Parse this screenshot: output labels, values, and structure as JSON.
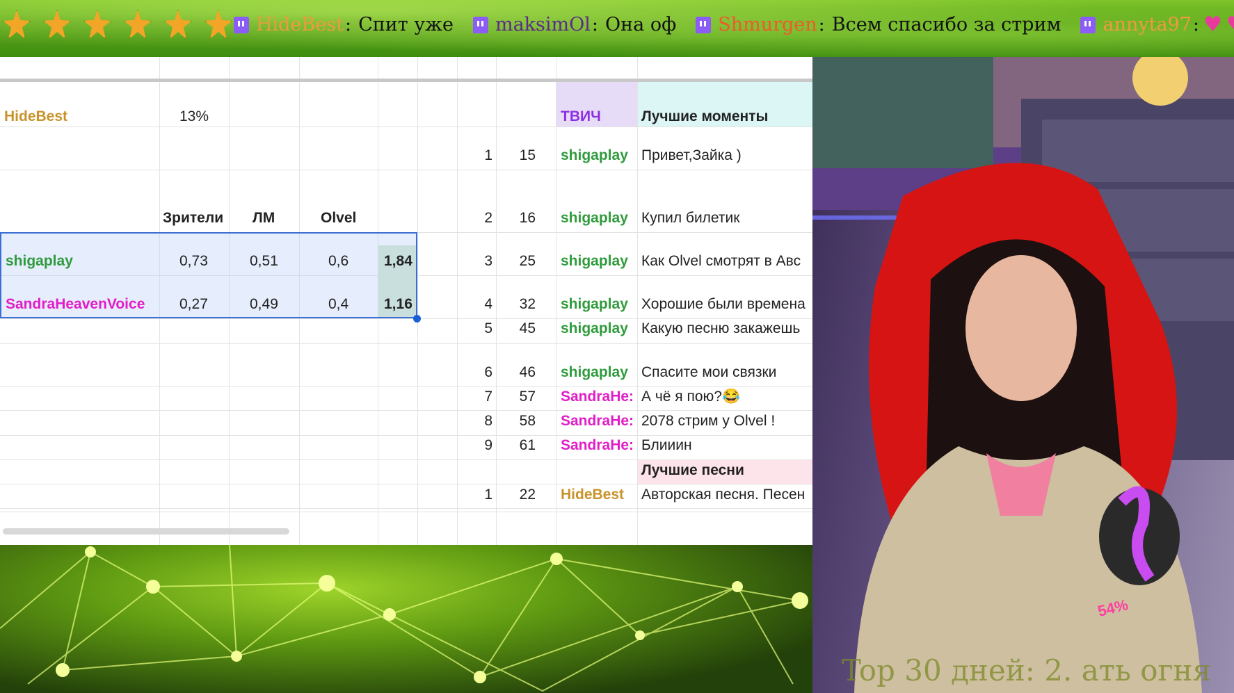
{
  "chat": {
    "messages": [
      {
        "user": "HideBest",
        "sep": ":",
        "text": "Спит уже",
        "user_color": "#f09a3e"
      },
      {
        "user": "maksimOl",
        "sep": ":",
        "text": "Она оф",
        "user_color": "#5b2a8c"
      },
      {
        "user": "Shmurgen",
        "sep": ":",
        "text": "Всем спасибо за стрим",
        "user_color": "#f05a2a"
      },
      {
        "user": "annyta97",
        "sep": ":",
        "text": "",
        "user_color": "#f09a3e"
      }
    ],
    "star_icon": "star-badge-icon",
    "platform_icon": "twitch-icon",
    "heart_icon": "heart-icon"
  },
  "sheet": {
    "left": {
      "header_user": "HideBest",
      "header_pct": "13%",
      "col_headers": [
        "Зрители",
        "ЛМ",
        "Olvel"
      ],
      "rows": [
        {
          "name": "shigaplay",
          "values": [
            "0,73",
            "0,51",
            "0,6"
          ],
          "total": "1,84"
        },
        {
          "name": "SandraHeavenVoice",
          "values": [
            "0,27",
            "0,49",
            "0,4"
          ],
          "total": "1,16"
        }
      ]
    },
    "right": {
      "col_twitch": "ТВИЧ",
      "col_best_moments": "Лучшие моменты",
      "moments": [
        {
          "n": "1",
          "t": "15",
          "user": "shigaplay",
          "text": "Привет,Зайка )"
        },
        {
          "n": "2",
          "t": "16",
          "user": "shigaplay",
          "text": "Купил билетик"
        },
        {
          "n": "3",
          "t": "25",
          "user": "shigaplay",
          "text": "Как Olvel смотрят в Авс"
        },
        {
          "n": "4",
          "t": "32",
          "user": "shigaplay",
          "text": "Хорошие были времена"
        },
        {
          "n": "5",
          "t": "45",
          "user": "shigaplay",
          "text": "Какую песню закажешь"
        },
        {
          "n": "6",
          "t": "46",
          "user": "shigaplay",
          "text": "Спасите мои связки"
        },
        {
          "n": "7",
          "t": "57",
          "user": "SandraHe:",
          "text": "А чё я пою?😂"
        },
        {
          "n": "8",
          "t": "58",
          "user": "SandraHe:",
          "text": "2078 стрим у Olvel !"
        },
        {
          "n": "9",
          "t": "61",
          "user": "SandraHe:",
          "text": "Блииин"
        }
      ],
      "best_songs_header": "Лучшие песни",
      "songs": [
        {
          "n": "1",
          "t": "22",
          "user": "HideBest",
          "text": "Авторская песня. Песен"
        }
      ]
    }
  },
  "overlay": {
    "mic_percent": "54%",
    "bottom_ticker": "Top 30 дней: 2. ать огня"
  },
  "colors": {
    "green_user": "#2f9b3c",
    "magenta_user": "#e21dc8",
    "gold_user": "#c9932b",
    "twitch_purple": "#8c2fe4",
    "ticker_green": "#5aa51a"
  }
}
